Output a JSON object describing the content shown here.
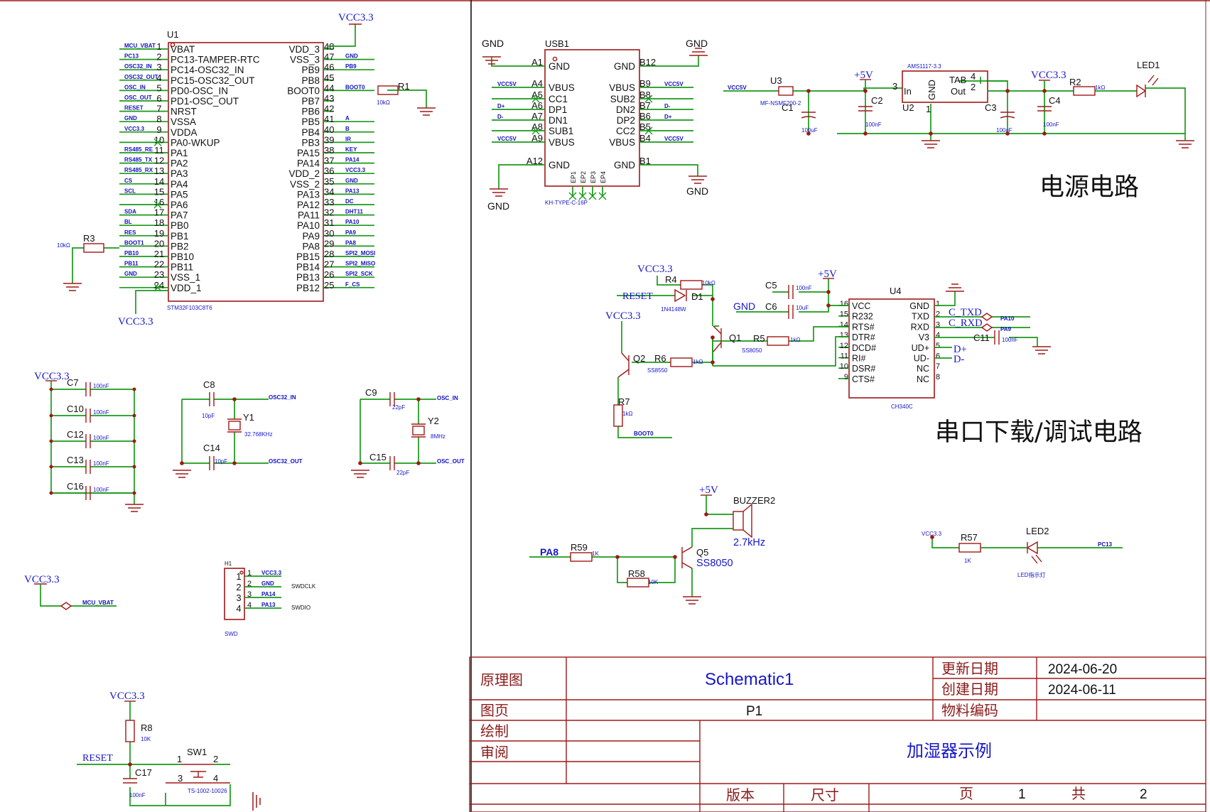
{
  "sections": {
    "power": "电源电路",
    "serial": "串口下载/调试电路"
  },
  "power_nets": {
    "vcc33": "VCC3.3",
    "p5v": "+5V",
    "gnd": "GND",
    "reset": "RESET",
    "pa8": "PA8"
  },
  "mcu": {
    "designator": "U1",
    "part": "STM32F103C8T6",
    "left_pins": [
      {
        "num": "1",
        "name": "VBAT",
        "net": "MCU_VBAT"
      },
      {
        "num": "2",
        "name": "PC13-TAMPER-RTC",
        "net": "PC13"
      },
      {
        "num": "3",
        "name": "PC14-OSC32_IN",
        "net": "OSC32_IN"
      },
      {
        "num": "4",
        "name": "PC15-OSC32_OUT",
        "net": "OSC32_OUT"
      },
      {
        "num": "5",
        "name": "PD0-OSC_IN",
        "net": "OSC_IN"
      },
      {
        "num": "6",
        "name": "PD1-OSC_OUT",
        "net": "OSC_OUT"
      },
      {
        "num": "7",
        "name": "NRST",
        "net": "RESET"
      },
      {
        "num": "8",
        "name": "VSSA",
        "net": "GND"
      },
      {
        "num": "9",
        "name": "VDDA",
        "net": "VCC3.3"
      },
      {
        "num": "10",
        "name": "PA0-WKUP",
        "net": ""
      },
      {
        "num": "11",
        "name": "PA1",
        "net": "RS485_RE"
      },
      {
        "num": "12",
        "name": "PA2",
        "net": "RS485_TX"
      },
      {
        "num": "13",
        "name": "PA3",
        "net": "RS485_RX"
      },
      {
        "num": "14",
        "name": "PA4",
        "net": "CS"
      },
      {
        "num": "15",
        "name": "PA5",
        "net": "SCL"
      },
      {
        "num": "16",
        "name": "PA6",
        "net": ""
      },
      {
        "num": "17",
        "name": "PA7",
        "net": "SDA"
      },
      {
        "num": "18",
        "name": "PB0",
        "net": "BL"
      },
      {
        "num": "19",
        "name": "PB1",
        "net": "RES"
      },
      {
        "num": "20",
        "name": "PB2",
        "net": "BOOT1"
      },
      {
        "num": "21",
        "name": "PB10",
        "net": "PB10"
      },
      {
        "num": "22",
        "name": "PB11",
        "net": "PB11"
      },
      {
        "num": "23",
        "name": "VSS_1",
        "net": "GND"
      },
      {
        "num": "24",
        "name": "VDD_1",
        "net": ""
      }
    ],
    "right_pins": [
      {
        "num": "48",
        "name": "VDD_3",
        "net": ""
      },
      {
        "num": "47",
        "name": "VSS_3",
        "net": "GND"
      },
      {
        "num": "46",
        "name": "PB9",
        "net": "PB9"
      },
      {
        "num": "45",
        "name": "PB8",
        "net": ""
      },
      {
        "num": "44",
        "name": "BOOT0",
        "net": "BOOT0"
      },
      {
        "num": "43",
        "name": "PB7",
        "net": ""
      },
      {
        "num": "42",
        "name": "PB6",
        "net": ""
      },
      {
        "num": "41",
        "name": "PB5",
        "net": "A"
      },
      {
        "num": "40",
        "name": "PB4",
        "net": "B"
      },
      {
        "num": "39",
        "name": "PB3",
        "net": "IR"
      },
      {
        "num": "38",
        "name": "PA15",
        "net": "KEY"
      },
      {
        "num": "37",
        "name": "PA14",
        "net": "PA14"
      },
      {
        "num": "36",
        "name": "VDD_2",
        "net": "VCC3.3"
      },
      {
        "num": "35",
        "name": "VSS_2",
        "net": "GND"
      },
      {
        "num": "34",
        "name": "PA13",
        "net": "PA13"
      },
      {
        "num": "33",
        "name": "PA12",
        "net": "DC"
      },
      {
        "num": "32",
        "name": "PA11",
        "net": "DHT11"
      },
      {
        "num": "31",
        "name": "PA10",
        "net": "PA10"
      },
      {
        "num": "30",
        "name": "PA9",
        "net": "PA9"
      },
      {
        "num": "29",
        "name": "PA8",
        "net": "PA8"
      },
      {
        "num": "28",
        "name": "PB15",
        "net": "SPI2_MOSI"
      },
      {
        "num": "27",
        "name": "PB14",
        "net": "SPI2_MISO"
      },
      {
        "num": "26",
        "name": "PB13",
        "net": "SPI2_SCK"
      },
      {
        "num": "25",
        "name": "PB12",
        "net": "F_CS"
      }
    ],
    "r1": {
      "ref": "R1",
      "value": "10kΩ"
    },
    "r3": {
      "ref": "R3",
      "value": "10kΩ"
    }
  },
  "usb": {
    "designator": "USB1",
    "part": "KH-TYPE-C-16P",
    "left_pins": [
      {
        "num": "A1",
        "name": "GND",
        "net": "GND"
      },
      {
        "num": "A4",
        "name": "VBUS",
        "net": "VCC5V"
      },
      {
        "num": "A5",
        "name": "CC1",
        "net": ""
      },
      {
        "num": "A6",
        "name": "DP1",
        "net": "D+"
      },
      {
        "num": "A7",
        "name": "DN1",
        "net": "D-"
      },
      {
        "num": "A8",
        "name": "SUB1",
        "net": ""
      },
      {
        "num": "A9",
        "name": "VBUS",
        "net": "VCC5V"
      },
      {
        "num": "A12",
        "name": "GND",
        "net": ""
      }
    ],
    "right_pins": [
      {
        "num": "B12",
        "name": "GND",
        "net": ""
      },
      {
        "num": "B9",
        "name": "VBUS",
        "net": "VCC5V"
      },
      {
        "num": "B8",
        "name": "SUB2",
        "net": ""
      },
      {
        "num": "B7",
        "name": "DN2",
        "net": "D-"
      },
      {
        "num": "B6",
        "name": "DP2",
        "net": "D+"
      },
      {
        "num": "B5",
        "name": "CC2",
        "net": ""
      },
      {
        "num": "B4",
        "name": "VBUS",
        "net": "VCC5V"
      },
      {
        "num": "B1",
        "name": "GND",
        "net": ""
      }
    ],
    "bottom_pins": [
      "EP1",
      "EP2",
      "EP3",
      "EP4"
    ]
  },
  "power": {
    "net_in": "VCC5V",
    "u3": {
      "ref": "U3",
      "part": "MF-NSMF200-2"
    },
    "u2": {
      "ref": "U2",
      "part": "AMS1117-3.3",
      "pin_in": "In",
      "pin_out": "Out",
      "pin_gnd": "GND",
      "pin_tab": "TAB",
      "n_in": "3",
      "n_tab": "4",
      "n_out": "2",
      "n_gnd": "1"
    },
    "c1": {
      "ref": "C1",
      "value": "100uF"
    },
    "c2": {
      "ref": "C2",
      "value": "100nF"
    },
    "c3": {
      "ref": "C3",
      "value": "100uF"
    },
    "c4": {
      "ref": "C4",
      "value": "100nF"
    },
    "r2": {
      "ref": "R2",
      "value": "1kΩ"
    },
    "led1": {
      "ref": "LED1"
    }
  },
  "serial": {
    "u4": {
      "ref": "U4",
      "part": "CH340C",
      "left_pins": [
        {
          "num": "16",
          "name": "VCC"
        },
        {
          "num": "15",
          "name": "R232"
        },
        {
          "num": "14",
          "name": "RTS#"
        },
        {
          "num": "13",
          "name": "DTR#"
        },
        {
          "num": "12",
          "name": "DCD#"
        },
        {
          "num": "11",
          "name": "RI#"
        },
        {
          "num": "10",
          "name": "DSR#"
        },
        {
          "num": "9",
          "name": "CTS#"
        }
      ],
      "right_pins": [
        {
          "num": "1",
          "name": "GND"
        },
        {
          "num": "2",
          "name": "TXD"
        },
        {
          "num": "3",
          "name": "RXD"
        },
        {
          "num": "4",
          "name": "V3"
        },
        {
          "num": "5",
          "name": "UD+"
        },
        {
          "num": "6",
          "name": "UD-"
        },
        {
          "num": "7",
          "name": "NC"
        },
        {
          "num": "8",
          "name": "NC"
        }
      ]
    },
    "r4": {
      "ref": "R4",
      "value": "10kΩ"
    },
    "r5": {
      "ref": "R5",
      "value": "1kΩ"
    },
    "r6": {
      "ref": "R6",
      "value": "1kΩ"
    },
    "r7": {
      "ref": "R7",
      "value": "1kΩ"
    },
    "d1": {
      "ref": "D1",
      "part": "1N4148W"
    },
    "c5": {
      "ref": "C5",
      "value": "100nF"
    },
    "c6": {
      "ref": "C6",
      "value": "10uF"
    },
    "c11": {
      "ref": "C11",
      "value": "100nF"
    },
    "q1": {
      "ref": "Q1",
      "part": "SS8050"
    },
    "q2": {
      "ref": "Q2",
      "part": "SS8550"
    },
    "c_txd": "C_TXD",
    "c_rxd": "C_RXD",
    "pa10": "PA10",
    "pa9": "PA9",
    "dp": "D+",
    "dm": "D-",
    "boot0": "BOOT0"
  },
  "decoupling": [
    {
      "ref": "C7",
      "value": "100nF"
    },
    {
      "ref": "C10",
      "value": "100nF"
    },
    {
      "ref": "C12",
      "value": "100nF"
    },
    {
      "ref": "C13",
      "value": "100nF"
    },
    {
      "ref": "C16",
      "value": "100nF"
    }
  ],
  "crystal32": {
    "c8": {
      "ref": "C8",
      "value": "10pF"
    },
    "c14": {
      "ref": "C14",
      "value": "10pF"
    },
    "y1": {
      "ref": "Y1",
      "value": "32.768KHz"
    },
    "net_in": "OSC32_IN",
    "net_out": "OSC32_OUT"
  },
  "crystal8": {
    "c9": {
      "ref": "C9",
      "value": "22pF"
    },
    "c15": {
      "ref": "C15",
      "value": "22pF"
    },
    "y2": {
      "ref": "Y2",
      "value": "8MHz"
    },
    "net_in": "OSC_IN",
    "net_out": "OSC_OUT"
  },
  "vbat": {
    "net": "MCU_VBAT"
  },
  "swd": {
    "ref": "H1",
    "label": "SWD",
    "pins": [
      {
        "num": "1",
        "net": "VCC3.3",
        "signal": ""
      },
      {
        "num": "2",
        "net": "GND",
        "signal": ""
      },
      {
        "num": "3",
        "net": "PA14",
        "signal": "SWDCLK"
      },
      {
        "num": "4",
        "net": "PA13",
        "signal": "SWDIO"
      }
    ]
  },
  "reset_circuit": {
    "r8": {
      "ref": "R8",
      "value": "10K"
    },
    "c17": {
      "ref": "C17",
      "value": "100nF"
    },
    "sw1": {
      "ref": "SW1",
      "part": "TS-1002-10026",
      "p1": "1",
      "p2": "2",
      "p3": "3",
      "p4": "4"
    }
  },
  "buzzer": {
    "ref": "BUZZER2",
    "value": "2.7kHz",
    "r59": {
      "ref": "R59",
      "value": "1K"
    },
    "r58": {
      "ref": "R58",
      "value": "10K"
    },
    "q5": {
      "ref": "Q5",
      "part": "SS8050"
    }
  },
  "led2": {
    "ref": "LED2",
    "desc": "LED指示灯",
    "r57": {
      "ref": "R57",
      "value": "1K"
    },
    "net_left": "VCC3.3",
    "net_right": "PC13"
  },
  "title_block": {
    "label_schematic": "原理图",
    "name": "Schematic1",
    "label_updated": "更新日期",
    "updated": "2024-06-20",
    "label_created": "创建日期",
    "created": "2024-06-11",
    "label_page": "图页",
    "page": "P1",
    "label_part": "物料编码",
    "label_drawn": "绘制",
    "label_review": "审阅",
    "project": "加湿器示例",
    "label_version": "版本",
    "label_size": "尺寸",
    "label_sheet": "页",
    "sheet": "1",
    "label_total": "共",
    "total": "2"
  },
  "colors": {
    "wire": "#1a9a1a",
    "symbol": "#a01818",
    "net": "#1616c8"
  }
}
